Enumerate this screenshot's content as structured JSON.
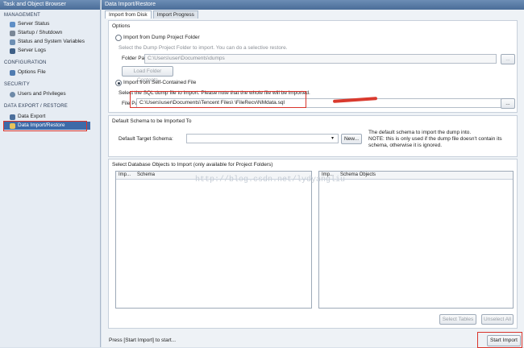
{
  "sidebar": {
    "title": "Task and Object Browser",
    "sections": [
      {
        "label": "MANAGEMENT",
        "items": [
          "Server Status",
          "Startup / Shutdown",
          "Status and System Variables",
          "Server Logs"
        ]
      },
      {
        "label": "CONFIGURATION",
        "items": [
          "Options File"
        ]
      },
      {
        "label": "SECURITY",
        "items": [
          "Users and Privileges"
        ]
      },
      {
        "label": "DATA EXPORT / RESTORE",
        "items": [
          "Data Export",
          "Data Import/Restore"
        ]
      }
    ],
    "selected_item": "Data Import/Restore"
  },
  "main": {
    "title": "Data Import/Restore",
    "tabs": [
      "Import from Disk",
      "Import Progress"
    ],
    "options": {
      "heading": "Options",
      "dump_folder_radio": "Import from Dump Project Folder",
      "dump_folder_hint": "Select the Dump Project Folder to import. You can do a selective restore.",
      "folder_path_label": "Folder Path",
      "folder_path_value": "C:\\Users\\user\\Documents\\dumps",
      "browse_label": "...",
      "load_contents_label": "Load Folder Contents",
      "self_contained_radio": "Import from Self-Contained File",
      "self_contained_hint": "Select the SQL dump file to import. Please note that the whole file will be imported.",
      "file_path_label": "File Path",
      "file_path_value": "C:\\Users\\user\\Documents\\Tencent Files\\                 \\FileRecv\\NMdata.sql"
    },
    "schema": {
      "heading": "Default Schema to be Imported To",
      "target_label": "Default Target Schema:",
      "new_button": "New...",
      "note": "The default schema to import the dump into.\nNOTE: this is only used if the dump file doesn't contain its schema, otherwise it is ignored."
    },
    "objects": {
      "heading": "Select Database Objects to Import (only available for Project Folders)",
      "left_cols": [
        "Imp...",
        "Schema"
      ],
      "right_cols": [
        "Imp...",
        "Schema Objects"
      ],
      "select_tables": "Select Tables",
      "unselect_all": "Unselect All"
    },
    "watermark": "http://blog.csdn.net/lydyangliu",
    "status_text": "Press [Start Import] to start...",
    "start_button": "Start Import"
  }
}
